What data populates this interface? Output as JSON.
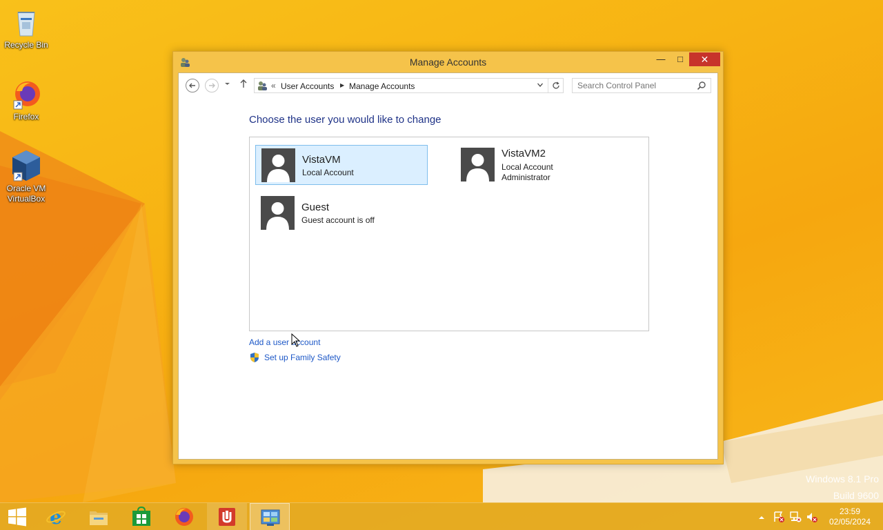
{
  "desktop": {
    "icons": [
      {
        "label": "Recycle Bin",
        "icon": "recycle-bin-icon"
      },
      {
        "label": "Firefox",
        "icon": "firefox-icon"
      },
      {
        "label": "Oracle VM VirtualBox",
        "icon": "virtualbox-icon"
      }
    ],
    "watermark": {
      "line1": "Windows 8.1 Pro",
      "line2": "Build 9600"
    }
  },
  "window": {
    "title": "Manage Accounts",
    "controls": {
      "minimize": "—",
      "maximize": "□",
      "close": "✕"
    },
    "address": {
      "overflow": "«",
      "breadcrumbs": [
        "User Accounts",
        "Manage Accounts"
      ]
    },
    "search": {
      "placeholder": "Search Control Panel"
    },
    "heading": "Choose the user you would like to change",
    "accounts": [
      {
        "name": "VistaVM",
        "lines": [
          "Local Account"
        ],
        "selected": true
      },
      {
        "name": "VistaVM2",
        "lines": [
          "Local Account",
          "Administrator"
        ],
        "selected": false
      },
      {
        "name": "Guest",
        "lines": [
          "Guest account is off"
        ],
        "selected": false
      }
    ],
    "links": {
      "add_user": "Add a user account",
      "family_safety": "Set up Family Safety"
    }
  },
  "taskbar": {
    "items": [
      {
        "icon": "start-icon"
      },
      {
        "icon": "internet-explorer-icon"
      },
      {
        "icon": "file-explorer-icon"
      },
      {
        "icon": "store-icon"
      },
      {
        "icon": "firefox-icon"
      },
      {
        "icon": "app-icon"
      },
      {
        "icon": "control-panel-icon",
        "active": true
      }
    ],
    "clock": {
      "time": "23:59",
      "date": "02/05/2024"
    }
  },
  "colors": {
    "accent": "#f7b313",
    "heading": "#1e3287",
    "link": "#1d58c7",
    "selection": "#dbefff",
    "close": "#c7332b"
  }
}
